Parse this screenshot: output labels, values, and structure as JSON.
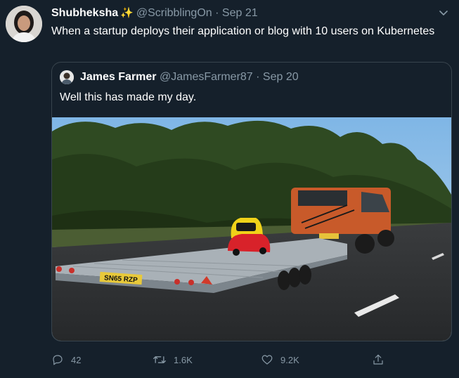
{
  "tweet": {
    "author_name": "Shubheksha",
    "author_handle": "@ScribblingOn",
    "separator": "·",
    "date": "Sep 21",
    "text": "When a startup deploys their application or blog with 10 users on Kubernetes"
  },
  "quoted_tweet": {
    "author_name": "James Farmer",
    "author_handle": "@JamesFarmer87",
    "separator": "·",
    "date": "Sep 20",
    "text": "Well this has made my day.",
    "photo": {
      "plate_text": "SN65 RZP"
    }
  },
  "actions": {
    "reply_count": "42",
    "retweet_count": "1.6K",
    "like_count": "9.2K"
  },
  "icons": {
    "sparkle": "sparkles-icon",
    "menu": "chevron-down-icon",
    "reply": "reply-icon",
    "retweet": "retweet-icon",
    "like": "heart-icon",
    "share": "share-icon"
  },
  "colors": {
    "background": "#15202b",
    "text": "#ffffff",
    "muted": "#8899a6",
    "border": "#38444d",
    "sparkle": "#f2c744"
  }
}
